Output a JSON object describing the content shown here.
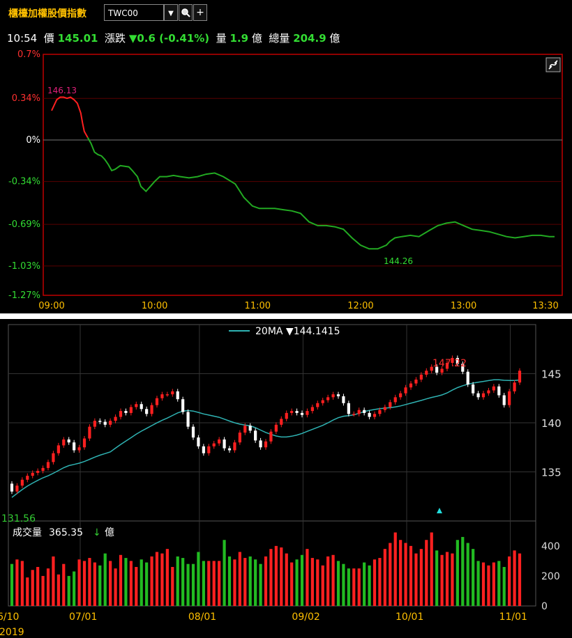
{
  "header": {
    "title": "櫃檯加權股價指數",
    "symbol": "TWC00",
    "dropdown_icon": "chevron-down-icon",
    "search_icon": "search-icon",
    "add_icon": "plus-icon"
  },
  "quote": {
    "time": "10:54",
    "price_label": "價",
    "price": "145.01",
    "change_label": "漲跌",
    "change": "▼0.6 (-0.41%)",
    "volume_label": "量",
    "volume": "1.9",
    "volume_unit": "億",
    "total_label": "總量",
    "total_volume": "204.9",
    "total_unit": "億"
  },
  "colors": {
    "up": "#ff2020",
    "down": "#33cc33",
    "ma": "#2fb3b3",
    "grid": "#5a0000",
    "high_label": "#e0207a"
  },
  "link_icon": "link-icon",
  "chart_data": [
    {
      "type": "line",
      "y_tick_labels": [
        "0.7%",
        "0.34%",
        "0%",
        "-0.34%",
        "-0.69%",
        "-1.03%",
        "-1.27%"
      ],
      "y_tick_values": [
        0.7,
        0.34,
        0,
        -0.34,
        -0.69,
        -1.03,
        -1.27
      ],
      "x_tick_labels": [
        "09:00",
        "10:00",
        "11:00",
        "12:00",
        "13:00",
        "13:30"
      ],
      "ylim": [
        -1.27,
        0.7
      ],
      "annotations": {
        "high": "146.13",
        "low": "144.26"
      },
      "series": [
        {
          "x": [
            0,
            3,
            5,
            7,
            9,
            11,
            13,
            15,
            17,
            18,
            19,
            21,
            23,
            25,
            27,
            29,
            31,
            33,
            35,
            37,
            40,
            45,
            47,
            50,
            52,
            55,
            60,
            63,
            67,
            71,
            75,
            80,
            85,
            90,
            95,
            100,
            107,
            112,
            117,
            121,
            125,
            130,
            135,
            140,
            145,
            150,
            155,
            160,
            165,
            170,
            175,
            180,
            185,
            190,
            195,
            197,
            200,
            204,
            209,
            214,
            220,
            225,
            230,
            235,
            240,
            245,
            250,
            255,
            260,
            265,
            270,
            275,
            280,
            285,
            290,
            293
          ],
          "y": [
            0.24,
            0.33,
            0.35,
            0.35,
            0.34,
            0.35,
            0.33,
            0.3,
            0.22,
            0.14,
            0.07,
            0.02,
            -0.03,
            -0.1,
            -0.12,
            -0.13,
            -0.16,
            -0.2,
            -0.25,
            -0.24,
            -0.21,
            -0.22,
            -0.25,
            -0.3,
            -0.38,
            -0.42,
            -0.34,
            -0.3,
            -0.3,
            -0.29,
            -0.3,
            -0.31,
            -0.3,
            -0.28,
            -0.27,
            -0.3,
            -0.36,
            -0.47,
            -0.54,
            -0.56,
            -0.56,
            -0.56,
            -0.57,
            -0.58,
            -0.6,
            -0.67,
            -0.7,
            -0.7,
            -0.71,
            -0.73,
            -0.8,
            -0.86,
            -0.89,
            -0.89,
            -0.86,
            -0.83,
            -0.8,
            -0.79,
            -0.78,
            -0.79,
            -0.74,
            -0.7,
            -0.68,
            -0.67,
            -0.7,
            -0.73,
            -0.74,
            -0.75,
            -0.77,
            -0.79,
            -0.8,
            -0.79,
            -0.78,
            -0.78,
            -0.79,
            -0.79
          ]
        }
      ]
    },
    {
      "type": "candlestick",
      "legend": "20MA ▼144.1415",
      "y_tick_labels": [
        "145",
        "140",
        "135"
      ],
      "y_tick_values": [
        145,
        140,
        135
      ],
      "ylim": [
        130,
        150
      ],
      "x_tick_labels": [
        "6/10",
        "07/01",
        "08/01",
        "09/02",
        "10/01",
        "11/01"
      ],
      "year_label": "2019",
      "annotations": {
        "high": "147.22",
        "low": "131.56"
      },
      "volume_label": "成交量",
      "volume_value": "365.35",
      "volume_arrow": "↓",
      "volume_unit": "億",
      "volume_y_tick_labels": [
        "400",
        "200",
        "0"
      ],
      "volume_y_tick_values": [
        400,
        200,
        0
      ],
      "closes": [
        133.0,
        133.6,
        134.2,
        134.6,
        134.9,
        135.1,
        135.4,
        136.0,
        136.9,
        137.7,
        138.3,
        138.0,
        137.2,
        137.5,
        138.4,
        139.6,
        140.2,
        140.1,
        139.8,
        140.2,
        140.6,
        141.2,
        141.0,
        141.6,
        141.9,
        141.4,
        140.9,
        141.8,
        142.5,
        142.9,
        142.9,
        143.2,
        142.4,
        141.1,
        139.6,
        138.5,
        137.6,
        136.9,
        137.6,
        137.9,
        138.3,
        137.4,
        137.2,
        138.0,
        139.0,
        139.7,
        139.2,
        138.2,
        137.5,
        138.1,
        139.1,
        139.8,
        140.4,
        141.0,
        141.2,
        141.0,
        140.8,
        141.2,
        141.6,
        142.0,
        142.3,
        142.6,
        142.9,
        142.7,
        142.0,
        140.9,
        140.9,
        141.3,
        141.0,
        140.6,
        140.9,
        141.3,
        141.6,
        142.1,
        142.6,
        143.0,
        143.6,
        144.0,
        144.4,
        144.9,
        145.3,
        145.7,
        145.1,
        145.5,
        146.1,
        146.6,
        146.0,
        145.2,
        143.9,
        143.0,
        142.6,
        143.0,
        143.3,
        143.7,
        142.8,
        141.8,
        143.2,
        144.1,
        145.3
      ],
      "volumes": [
        280,
        310,
        300,
        190,
        240,
        260,
        200,
        250,
        330,
        210,
        280,
        200,
        230,
        310,
        300,
        320,
        290,
        270,
        350,
        300,
        250,
        340,
        320,
        300,
        260,
        310,
        290,
        330,
        360,
        350,
        380,
        260,
        330,
        320,
        280,
        280,
        360,
        300,
        300,
        300,
        300,
        440,
        330,
        310,
        360,
        320,
        330,
        310,
        280,
        330,
        380,
        400,
        390,
        350,
        290,
        310,
        340,
        380,
        320,
        310,
        270,
        330,
        340,
        300,
        280,
        250,
        250,
        250,
        290,
        270,
        310,
        320,
        380,
        420,
        490,
        440,
        420,
        400,
        350,
        380,
        440,
        490,
        370,
        340,
        360,
        350,
        440,
        460,
        420,
        380,
        300,
        290,
        270,
        290,
        300,
        260,
        330,
        370,
        350
      ]
    }
  ]
}
